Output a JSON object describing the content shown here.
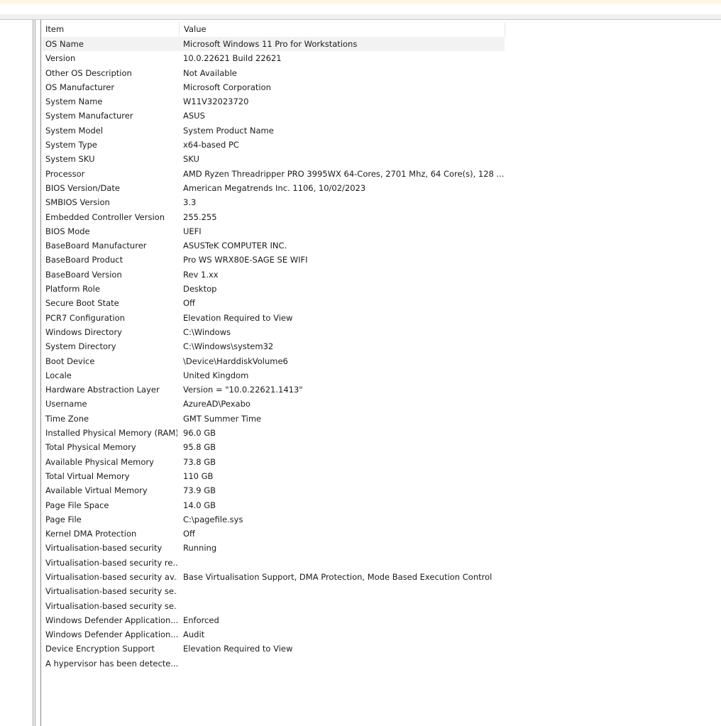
{
  "columns": {
    "item": "Item",
    "value": "Value"
  },
  "rows": [
    {
      "item": "OS Name",
      "value": "Microsoft Windows 11 Pro for Workstations"
    },
    {
      "item": "Version",
      "value": "10.0.22621 Build 22621"
    },
    {
      "item": "Other OS Description",
      "value": "Not Available"
    },
    {
      "item": "OS Manufacturer",
      "value": "Microsoft Corporation"
    },
    {
      "item": "System Name",
      "value": "W11V32023720"
    },
    {
      "item": "System Manufacturer",
      "value": "ASUS"
    },
    {
      "item": "System Model",
      "value": "System Product Name"
    },
    {
      "item": "System Type",
      "value": "x64-based PC"
    },
    {
      "item": "System SKU",
      "value": "SKU"
    },
    {
      "item": "Processor",
      "value": "AMD Ryzen Threadripper PRO 3995WX 64-Cores, 2701 Mhz, 64 Core(s), 128 ..."
    },
    {
      "item": "BIOS Version/Date",
      "value": "American Megatrends Inc. 1106, 10/02/2023"
    },
    {
      "item": "SMBIOS Version",
      "value": "3.3"
    },
    {
      "item": "Embedded Controller Version",
      "value": "255.255"
    },
    {
      "item": "BIOS Mode",
      "value": "UEFI"
    },
    {
      "item": "BaseBoard Manufacturer",
      "value": "ASUSTeK COMPUTER INC."
    },
    {
      "item": "BaseBoard Product",
      "value": "Pro WS WRX80E-SAGE SE WIFI"
    },
    {
      "item": "BaseBoard Version",
      "value": "Rev 1.xx"
    },
    {
      "item": "Platform Role",
      "value": "Desktop"
    },
    {
      "item": "Secure Boot State",
      "value": "Off"
    },
    {
      "item": "PCR7 Configuration",
      "value": "Elevation Required to View"
    },
    {
      "item": "Windows Directory",
      "value": "C:\\Windows"
    },
    {
      "item": "System Directory",
      "value": "C:\\Windows\\system32"
    },
    {
      "item": "Boot Device",
      "value": "\\Device\\HarddiskVolume6"
    },
    {
      "item": "Locale",
      "value": "United Kingdom"
    },
    {
      "item": "Hardware Abstraction Layer",
      "value": "Version = \"10.0.22621.1413\""
    },
    {
      "item": "Username",
      "value": "AzureAD\\Pexabo"
    },
    {
      "item": "Time Zone",
      "value": "GMT Summer Time"
    },
    {
      "item": "Installed Physical Memory (RAM)",
      "value": "96.0 GB"
    },
    {
      "item": "Total Physical Memory",
      "value": "95.8 GB"
    },
    {
      "item": "Available Physical Memory",
      "value": "73.8 GB"
    },
    {
      "item": "Total Virtual Memory",
      "value": "110 GB"
    },
    {
      "item": "Available Virtual Memory",
      "value": "73.9 GB"
    },
    {
      "item": "Page File Space",
      "value": "14.0 GB"
    },
    {
      "item": "Page File",
      "value": "C:\\pagefile.sys"
    },
    {
      "item": "Kernel DMA Protection",
      "value": "Off"
    },
    {
      "item": "Virtualisation-based security",
      "value": "Running"
    },
    {
      "item": "Virtualisation-based security re...",
      "value": ""
    },
    {
      "item": "Virtualisation-based security av...",
      "value": "Base Virtualisation Support, DMA Protection, Mode Based Execution Control"
    },
    {
      "item": "Virtualisation-based security se...",
      "value": ""
    },
    {
      "item": "Virtualisation-based security se...",
      "value": ""
    },
    {
      "item": "Windows Defender Application...",
      "value": "Enforced"
    },
    {
      "item": "Windows Defender Application...",
      "value": "Audit"
    },
    {
      "item": "Device Encryption Support",
      "value": "Elevation Required to View"
    },
    {
      "item": "A hypervisor has been detecte...",
      "value": ""
    }
  ]
}
